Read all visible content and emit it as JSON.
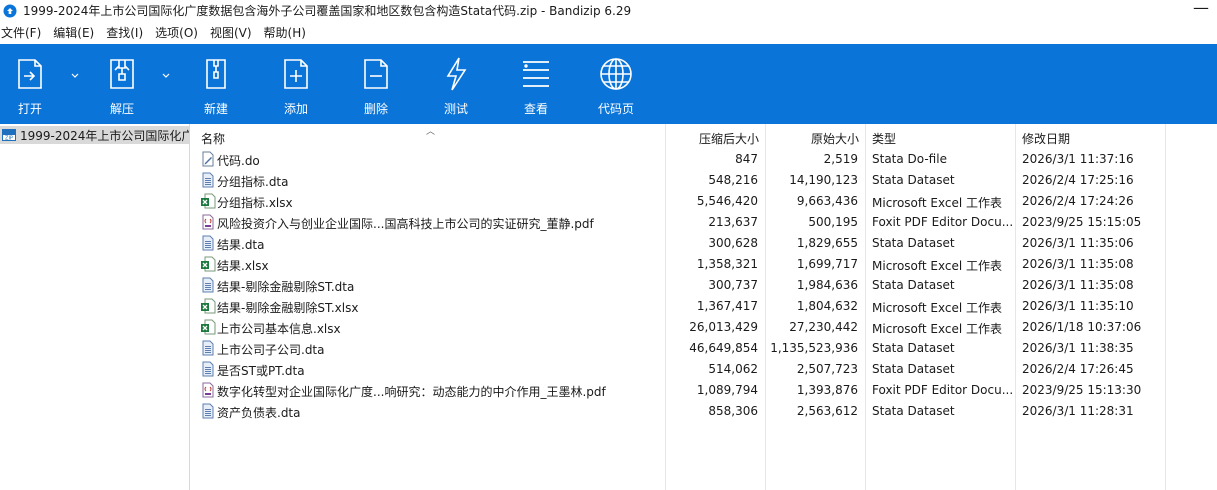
{
  "window": {
    "title": "1999-2024年上市公司国际化广度数据包含海外子公司覆盖国家和地区数包含构造Stata代码.zip - Bandizip 6.29",
    "minimize_glyph": "—"
  },
  "menu": [
    "文件(F)",
    "编辑(E)",
    "查找(I)",
    "选项(O)",
    "视图(V)",
    "帮助(H)"
  ],
  "toolbar": {
    "open": "打开",
    "extract": "解压",
    "new": "新建",
    "add": "添加",
    "delete": "删除",
    "test": "测试",
    "view": "查看",
    "codepage": "代码页"
  },
  "tree": {
    "item": "1999-2024年上市公司国际化广"
  },
  "columns": {
    "name": "名称",
    "compressed": "压缩后大小",
    "original": "原始大小",
    "type": "类型",
    "modified": "修改日期"
  },
  "files": [
    {
      "name": "代码.do",
      "compressed": "847",
      "original": "2,519",
      "type": "Stata Do-file",
      "modified": "2026/3/1 11:37:16",
      "icon": "do"
    },
    {
      "name": "分组指标.dta",
      "compressed": "548,216",
      "original": "14,190,123",
      "type": "Stata Dataset",
      "modified": "2026/2/4 17:25:16",
      "icon": "dta"
    },
    {
      "name": "分组指标.xlsx",
      "compressed": "5,546,420",
      "original": "9,663,436",
      "type": "Microsoft Excel 工作表",
      "modified": "2026/2/4 17:24:26",
      "icon": "xlsx"
    },
    {
      "name": "风险投资介入与创业企业国际...国高科技上市公司的实证研究_董静.pdf",
      "compressed": "213,637",
      "original": "500,195",
      "type": "Foxit PDF Editor Docu...",
      "modified": "2023/9/25 15:15:05",
      "icon": "pdf"
    },
    {
      "name": "结果.dta",
      "compressed": "300,628",
      "original": "1,829,655",
      "type": "Stata Dataset",
      "modified": "2026/3/1 11:35:06",
      "icon": "dta"
    },
    {
      "name": "结果.xlsx",
      "compressed": "1,358,321",
      "original": "1,699,717",
      "type": "Microsoft Excel 工作表",
      "modified": "2026/3/1 11:35:08",
      "icon": "xlsx"
    },
    {
      "name": "结果-剔除金融剔除ST.dta",
      "compressed": "300,737",
      "original": "1,984,636",
      "type": "Stata Dataset",
      "modified": "2026/3/1 11:35:08",
      "icon": "dta"
    },
    {
      "name": "结果-剔除金融剔除ST.xlsx",
      "compressed": "1,367,417",
      "original": "1,804,632",
      "type": "Microsoft Excel 工作表",
      "modified": "2026/3/1 11:35:10",
      "icon": "xlsx"
    },
    {
      "name": "上市公司基本信息.xlsx",
      "compressed": "26,013,429",
      "original": "27,230,442",
      "type": "Microsoft Excel 工作表",
      "modified": "2026/1/18 10:37:06",
      "icon": "xlsx"
    },
    {
      "name": "上市公司子公司.dta",
      "compressed": "46,649,854",
      "original": "1,135,523,936",
      "type": "Stata Dataset",
      "modified": "2026/3/1 11:38:35",
      "icon": "dta"
    },
    {
      "name": "是否ST或PT.dta",
      "compressed": "514,062",
      "original": "2,507,723",
      "type": "Stata Dataset",
      "modified": "2026/2/4 17:26:45",
      "icon": "dta"
    },
    {
      "name": "数字化转型对企业国际化广度...响研究：动态能力的中介作用_王墨林.pdf",
      "compressed": "1,089,794",
      "original": "1,393,876",
      "type": "Foxit PDF Editor Docu...",
      "modified": "2023/9/25 15:13:30",
      "icon": "pdf"
    },
    {
      "name": "资产负债表.dta",
      "compressed": "858,306",
      "original": "2,563,612",
      "type": "Stata Dataset",
      "modified": "2026/3/1 11:28:31",
      "icon": "dta"
    }
  ],
  "colors": {
    "toolbar_bg": "#0a74d8",
    "selection": "#d9d9d9"
  }
}
